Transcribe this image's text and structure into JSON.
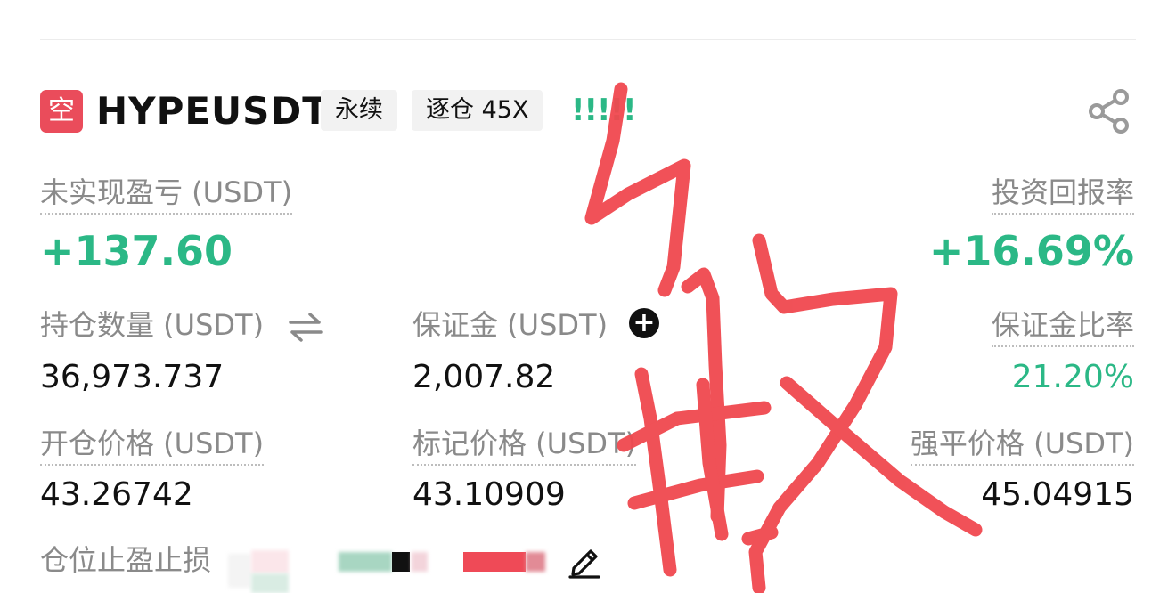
{
  "header": {
    "side_badge": "空",
    "symbol": "HYPEUSDT",
    "tag_contract": "永续",
    "tag_margin": "逐仓 45X",
    "signal_bars": "!!!!!"
  },
  "pnl": {
    "label": "未实现盈亏 (USDT)",
    "value": "+137.60"
  },
  "roi": {
    "label": "投资回报率",
    "value": "+16.69%"
  },
  "position_size": {
    "label": "持仓数量 (USDT)",
    "value": "36,973.737"
  },
  "margin": {
    "label": "保证金 (USDT)",
    "value": "2,007.82"
  },
  "margin_ratio": {
    "label": "保证金比率",
    "value": "21.20%"
  },
  "entry_price": {
    "label": "开仓价格 (USDT)",
    "value": "43.26742"
  },
  "mark_price": {
    "label": "标记价格 (USDT)",
    "value": "43.10909"
  },
  "liq_price": {
    "label": "强平价格 (USDT)",
    "value": "45.04915"
  },
  "tpsl": {
    "label": "仓位止盈止损"
  },
  "colors": {
    "profit": "#2bb886",
    "short": "#ea4c5b",
    "overlay": "#f0484f"
  },
  "icons": {
    "share": "share-icon",
    "swap": "swap-icon",
    "add": "plus-circle-icon",
    "edit": "pencil-icon"
  }
}
